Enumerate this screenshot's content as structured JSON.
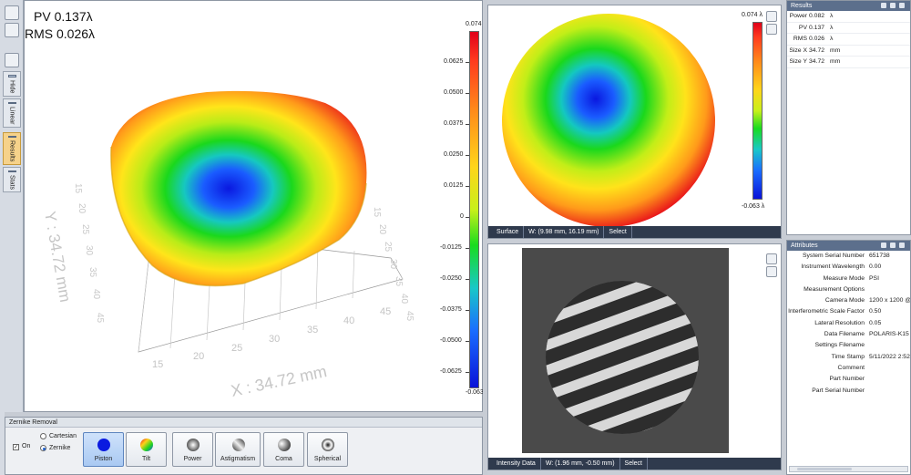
{
  "view3d": {
    "metrics": {
      "pv": "PV 0.137λ",
      "rms": "RMS 0.026λ"
    },
    "axis_x_label": "X : 34.72 mm",
    "axis_y_label": "Y : 34.72 mm",
    "x_ticks": [
      "15",
      "20",
      "25",
      "30",
      "35",
      "40",
      "45"
    ],
    "y_ticks": [
      "15",
      "20",
      "25",
      "30",
      "35",
      "40",
      "45"
    ],
    "z_ticks": [
      "15",
      "20",
      "25",
      "30",
      "35",
      "40",
      "45"
    ],
    "colorbar": {
      "max": "0.074 λ",
      "min": "-0.063 λ",
      "ticks": [
        "0.0625",
        "0.0500",
        "0.0375",
        "0.0250",
        "0.0125",
        "0",
        "-0.0125",
        "-0.0250",
        "-0.0375",
        "-0.0500",
        "-0.0625"
      ]
    }
  },
  "left_tabs": {
    "items": [
      {
        "label": "Hide",
        "icon": "hide-icon"
      },
      {
        "label": "Linear",
        "icon": "linear-icon"
      },
      {
        "label": "Results",
        "icon": "results-icon"
      },
      {
        "label": "Stats",
        "icon": "stats-icon"
      }
    ]
  },
  "zernike": {
    "title": "Zernike Removal",
    "on_label": "On",
    "cartesian_label": "Cartesian",
    "zernike_label": "Zernike",
    "buttons": [
      "Piston",
      "Tilt",
      "Power",
      "Astigmatism",
      "Coma",
      "Spherical"
    ]
  },
  "surface": {
    "colorbar_max": "0.074 λ",
    "colorbar_min": "-0.063 λ",
    "status": {
      "name": "Surface",
      "coords": "W: (9.98 mm, 16.19 mm)",
      "mode": "Select"
    }
  },
  "intensity": {
    "status": {
      "name": "Intensity Data",
      "coords": "W: (1.96 mm, -0.50 mm)",
      "mode": "Select"
    }
  },
  "results": {
    "title": "Results",
    "rows": [
      {
        "key": "Power",
        "value": "0.082",
        "unit": "λ"
      },
      {
        "key": "PV",
        "value": "0.137",
        "unit": "λ"
      },
      {
        "key": "RMS",
        "value": "0.026",
        "unit": "λ"
      },
      {
        "key": "Size X",
        "value": "34.72",
        "unit": "mm"
      },
      {
        "key": "Size Y",
        "value": "34.72",
        "unit": "mm"
      }
    ]
  },
  "attributes": {
    "title": "Attributes",
    "rows": [
      {
        "key": "System Serial Number",
        "value": "651738"
      },
      {
        "key": "Instrument Wavelength",
        "value": "0.00"
      },
      {
        "key": "Measure Mode",
        "value": "PSI"
      },
      {
        "key": "Measurement Options",
        "value": ""
      },
      {
        "key": "Camera Mode",
        "value": "1200 x 1200 @"
      },
      {
        "key": "Interferometric Scale Factor",
        "value": "0.50"
      },
      {
        "key": "Lateral Resolution",
        "value": "0.05"
      },
      {
        "key": "Data Filename",
        "value": "POLARIS-K15 60"
      },
      {
        "key": "Settings Filename",
        "value": ""
      },
      {
        "key": "Time Stamp",
        "value": "5/11/2022 2:52:"
      },
      {
        "key": "Comment",
        "value": ""
      },
      {
        "key": "Part Number",
        "value": ""
      },
      {
        "key": "Part Serial Number",
        "value": ""
      }
    ]
  },
  "colors": {
    "accent": "#5c6f8c",
    "statusbar": "#2f3a4d",
    "active_tab": "#f6d28a"
  }
}
